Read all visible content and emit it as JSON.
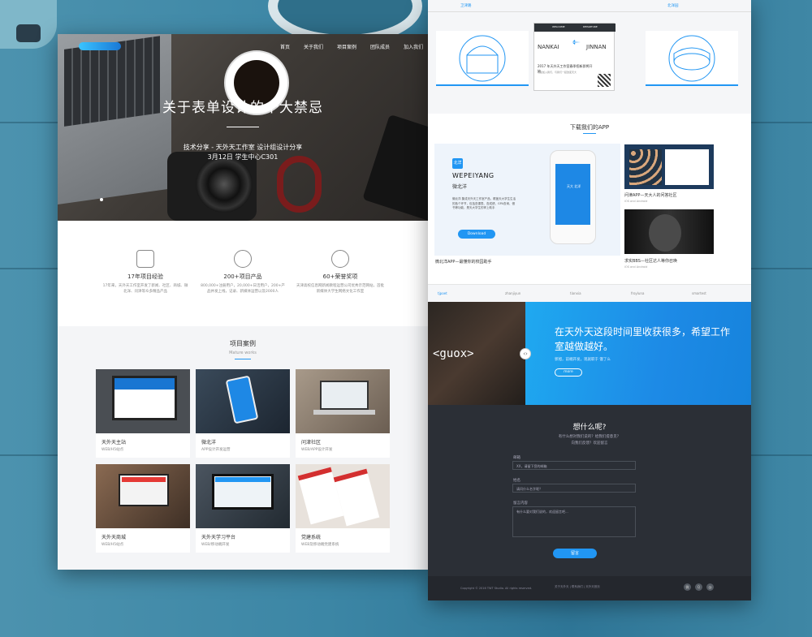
{
  "left_page": {
    "nav": [
      "首页",
      "关于我们",
      "项目案例",
      "团队成员",
      "加入我们"
    ],
    "hero": {
      "title": "关于表单设计的十大禁忌",
      "subtitle": "技术分享 - 天外天工作室 设计组设计分享",
      "info": "3月12日 学生中心C301"
    },
    "features": [
      {
        "title": "17年项目经验",
        "icon": "thumbs-up-icon",
        "desc": "17年来，天外天工作室开发了新闻、社区、商城、微北洋、问津等众多精品产品"
      },
      {
        "title": "200+项目产品",
        "icon": "team-icon",
        "desc": "800,000+注册用户，20,000+日活用户，200+产品并发上线，记录、新媒体运营以及2000人"
      },
      {
        "title": "60+荣誉奖项",
        "icon": "award-icon",
        "desc": "天津高校信息网新闻教程运营公司优秀示范网站，首批新媒体大学生网络文化工作室"
      }
    ],
    "works": {
      "title": "项目案例",
      "subtitle": "Mature works",
      "cards": [
        {
          "title": "天外天主站",
          "sub": "WEB/H5站点"
        },
        {
          "title": "微北洋",
          "sub": "APP设计开发运营"
        },
        {
          "title": "问津社区",
          "sub": "WEB/APP设计开发"
        },
        {
          "title": "天外天商城",
          "sub": "WEB/H5站点"
        },
        {
          "title": "天外天学习平台",
          "sub": "WEB/移动端开发"
        },
        {
          "title": "党建系统",
          "sub": "WEB及移动端党建系统"
        }
      ]
    }
  },
  "right_page": {
    "stations": {
      "left": "卫津路",
      "right": "北洋园"
    },
    "ticket": {
      "from_code": "NANKAI",
      "to_code": "JINNAN",
      "head_left": "WELCOME",
      "head_right": "DEPARTURE",
      "text": "2017 年天外天工作室春季招新即将开始",
      "sub": "欢迎加入我们，与我们一起改变天大"
    },
    "app": {
      "title": "下载我们的APP",
      "icon_text": "北洋",
      "name": "WEPEIYANG",
      "cn_name": "微北洋",
      "desc": "微北洋 集成天外天工作室产品，覆盖天大学生生活的各个环节，包括查课表、查成绩、GPA查询、借书等功能，是天大学生的掌上助手",
      "download": "Download",
      "caption": "微北洋APP—最懂你的校园助手",
      "phone_text": "天大 北洋",
      "tiles": [
        {
          "caption": "问津APP—天大人的问答社区",
          "sub": "iOS and Android"
        },
        {
          "caption": "求实BBS—社区达人等你召唤",
          "sub": "iOS and Android"
        }
      ]
    },
    "tabs": [
      "tjpoet",
      "zhanjiyun",
      "tianxia",
      "froyluna",
      "smartest"
    ],
    "banner": {
      "code_text": "<guox>",
      "text": "在天外天这段时间里收获很多，希望工作室越做越好。",
      "small": "郭旭，前端开发，现就职于 饿了么",
      "more": "more",
      "arrow": "‹›"
    },
    "message": {
      "title": "想什么呢?",
      "sub1": "有什么想对我们说的？给我们提意见？",
      "sub2": "向我们反馈？欢迎留言",
      "label_email": "邮箱",
      "ph_email": "XX，请留下您的邮箱",
      "label_name": "姓名",
      "ph_name": "请问什么名字呢？",
      "label_content": "留言内容",
      "ph_content": "有什么要对我们说的，欢迎留言吧...",
      "submit": "留言"
    },
    "footer": {
      "copyright": "Copyright © 2016 TWT Studio. All rights reserved.",
      "links": "关于天外天 | 联系我们 | 天外天首页",
      "social": [
        "微",
        "Q",
        "@"
      ]
    }
  }
}
